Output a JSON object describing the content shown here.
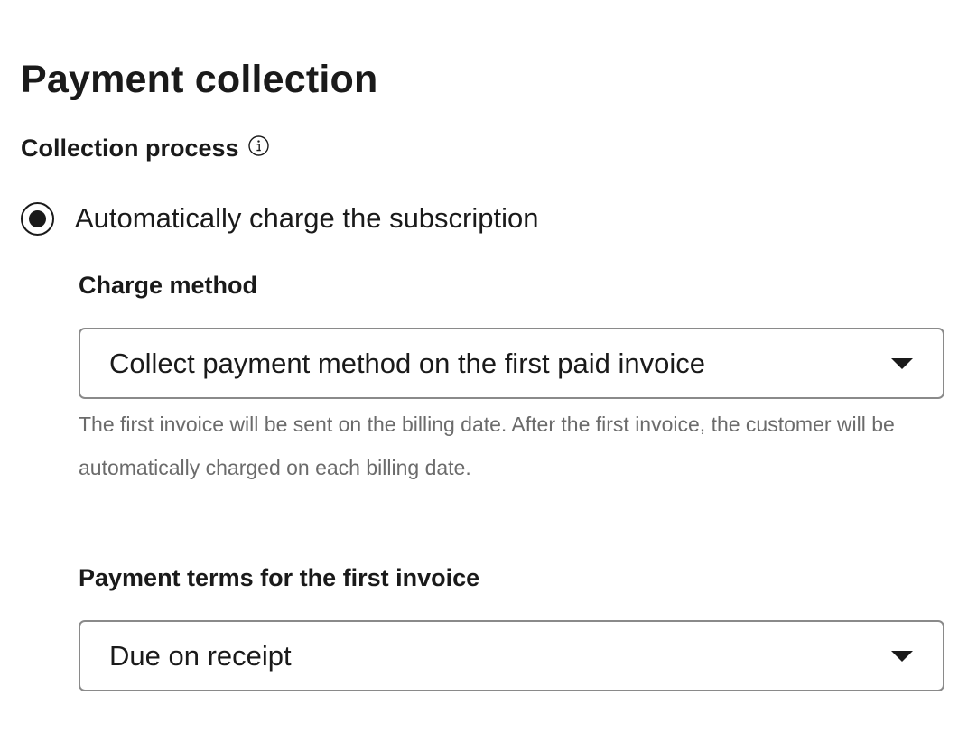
{
  "page": {
    "title": "Payment collection"
  },
  "collection_process": {
    "label": "Collection process",
    "info_icon": "info-icon",
    "selected_option": {
      "label": "Automatically charge the subscription",
      "checked": true
    }
  },
  "charge_method": {
    "label": "Charge method",
    "selected_value": "Collect payment method on the first paid invoice",
    "help_text": "The first invoice will be sent on the billing date. After the first invoice, the customer will be automatically charged on each billing date."
  },
  "payment_terms": {
    "label": "Payment terms for the first invoice",
    "selected_value": "Due on receipt"
  },
  "icons": {
    "dropdown": "chevron-down-icon",
    "info": "info-icon"
  },
  "colors": {
    "text": "#1a1a1a",
    "muted_text": "#6b6b6b",
    "border": "#8a8a8a",
    "background": "#ffffff"
  }
}
